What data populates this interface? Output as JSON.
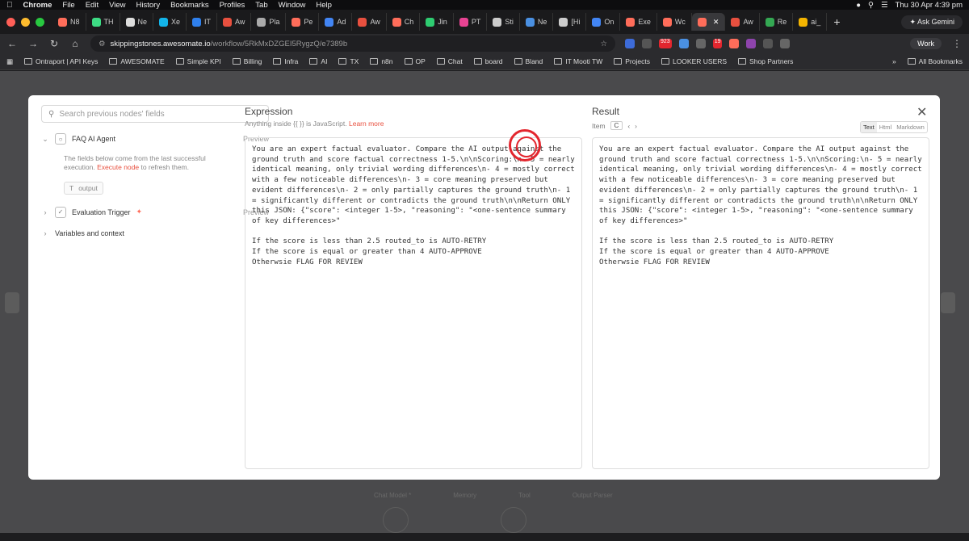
{
  "menubar": {
    "app_name": "Chrome",
    "menus": [
      "File",
      "Edit",
      "View",
      "History",
      "Bookmarks",
      "Profiles",
      "Tab",
      "Window",
      "Help"
    ],
    "clock": "Thu 30 Apr  4:39 pm"
  },
  "tabs": [
    {
      "label": "N8",
      "color": "#ff6d5a"
    },
    {
      "label": "TH",
      "color": "#3ddc84"
    },
    {
      "label": "Ne",
      "color": "#dddddd"
    },
    {
      "label": "Xe",
      "color": "#13b5ea"
    },
    {
      "label": "IT",
      "color": "#2f80ed"
    },
    {
      "label": "Aw",
      "color": "#e8503f"
    },
    {
      "label": "Pla",
      "color": "#aaaaaa"
    },
    {
      "label": "Pe",
      "color": "#ff6d5a"
    },
    {
      "label": "Ad",
      "color": "#4285f4"
    },
    {
      "label": "Aw",
      "color": "#e8503f"
    },
    {
      "label": "Ch",
      "color": "#ff6d5a"
    },
    {
      "label": "Jin",
      "color": "#2ecc71"
    },
    {
      "label": "PT",
      "color": "#e84393"
    },
    {
      "label": "Sti",
      "color": "#cccccc"
    },
    {
      "label": "Ne",
      "color": "#4a90e2"
    },
    {
      "label": "[Hi",
      "color": "#cccccc"
    },
    {
      "label": "On",
      "color": "#4285f4"
    },
    {
      "label": "Exe",
      "color": "#ff6d5a"
    },
    {
      "label": "Wc",
      "color": "#ff6d5a"
    },
    {
      "label": "",
      "color": "#ff6d5a"
    },
    {
      "label": "Aw",
      "color": "#e8503f"
    },
    {
      "label": "Re",
      "color": "#34a853"
    },
    {
      "label": "ai_",
      "color": "#f4b400"
    }
  ],
  "ask_gemini": "Ask Gemini",
  "url": {
    "host": "skippingstones.awesomate.io",
    "path": "/workflow/5RkMxDZGEI5RygzQ/e7389b"
  },
  "extension_badges": {
    "a": "923",
    "b": "19"
  },
  "profile": "Work",
  "bookmarks": [
    "Ontraport | API Keys",
    "AWESOMATE",
    "Simple KPI",
    "Billing",
    "Infra",
    "AI",
    "TX",
    "n8n",
    "OP",
    "Chat",
    "board",
    "Bland",
    "IT Mooti TW",
    "Projects",
    "LOOKER USERS",
    "Shop Partners"
  ],
  "all_bookmarks": "All Bookmarks",
  "background_nodes": [
    "Chat Model *",
    "Memory",
    "Tool",
    "Output Parser"
  ],
  "left_panel": {
    "search_placeholder": "Search previous nodes' fields",
    "node1": {
      "name": "FAQ AI Agent",
      "preview": "Preview"
    },
    "note_text": "The fields below come from the last successful execution. ",
    "note_link": "Execute node",
    "note_after": " to refresh them.",
    "field_chip": "output",
    "node2": {
      "name": "Evaluation Trigger",
      "preview": "Preview"
    },
    "variables": "Variables and context"
  },
  "expression": {
    "title": "Expression",
    "subtitle": "Anything inside {{ }} is JavaScript. ",
    "learn_more": "Learn more",
    "code": "You are an expert factual evaluator. Compare the AI output against the ground truth and score factual correctness 1-5.\\n\\nScoring:\\n- 5 = nearly identical meaning, only trivial wording differences\\n- 4 = mostly correct with a few noticeable differences\\n- 3 = core meaning preserved but evident differences\\n- 2 = only partially captures the ground truth\\n- 1 = significantly different or contradicts the ground truth\\n\\nReturn ONLY this JSON: {\"score\": <integer 1-5>, \"reasoning\": \"<one-sentence summary of key differences>\"\n\nIf the score is less than 2.5 routed_to is AUTO-RETRY\nIf the score is equal or greater than 4 AUTO-APPROVE\nOtherwsie FLAG FOR REVIEW"
  },
  "result": {
    "title": "Result",
    "item_label": "Item",
    "item_value": "C",
    "formats": [
      "Text",
      "Html",
      "Markdown"
    ],
    "active_format": "Text",
    "code": "You are an expert factual evaluator. Compare the AI output against the ground truth and score factual correctness 1-5.\\n\\nScoring:\\n- 5 = nearly identical meaning, only trivial wording differences\\n- 4 = mostly correct with a few noticeable differences\\n- 3 = core meaning preserved but evident differences\\n- 2 = only partially captures the ground truth\\n- 1 = significantly different or contradicts the ground truth\\n\\nReturn ONLY this JSON: {\"score\": <integer 1-5>, \"reasoning\": \"<one-sentence summary of key differences>\"\n\nIf the score is less than 2.5 routed_to is AUTO-RETRY\nIf the score is equal or greater than 4 AUTO-APPROVE\nOtherwsie FLAG FOR REVIEW"
  }
}
